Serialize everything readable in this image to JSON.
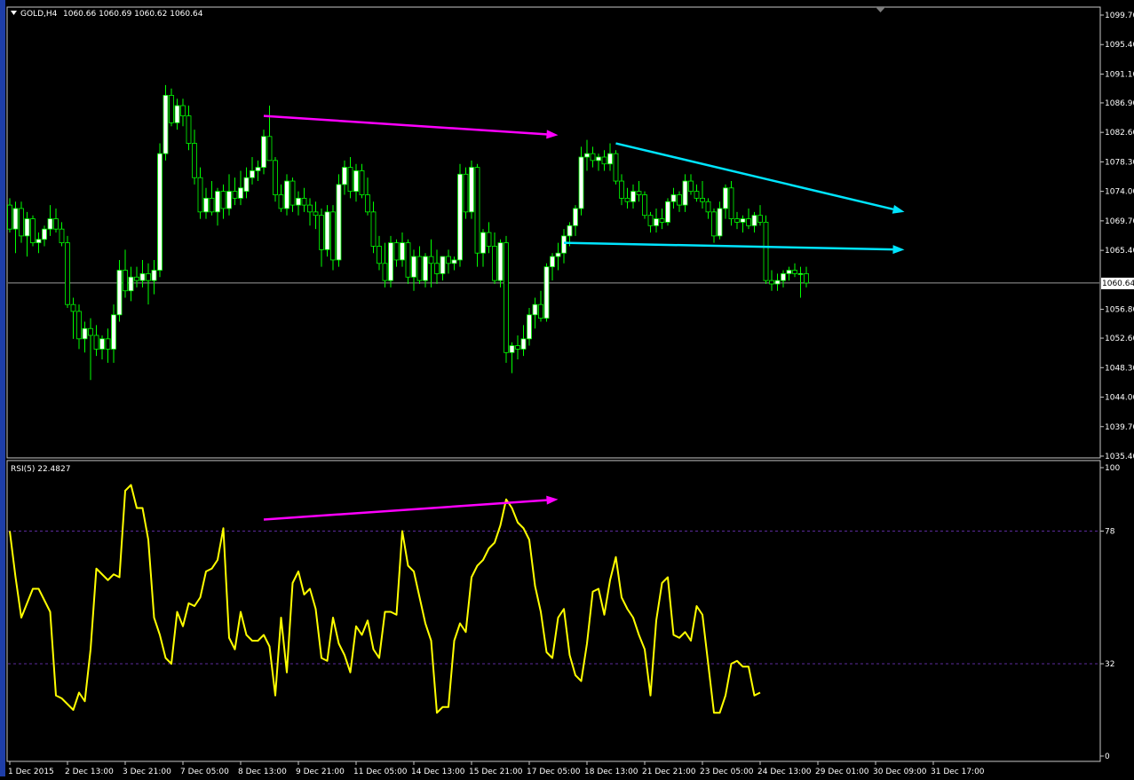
{
  "chart_data": [
    {
      "type": "candlestick",
      "title": "GOLD,H4",
      "ohlc_header": "1060.66 1060.69 1060.62 1060.64",
      "current_price_label": "1060.64",
      "current_price": 1060.64,
      "ylim": [
        1035.4,
        1099.7
      ],
      "y_ticks": [
        "1099.70",
        "1095.40",
        "1091.10",
        "1086.90",
        "1082.60",
        "1078.30",
        "1074.00",
        "1069.70",
        "1065.40",
        "1060.64",
        "1056.80",
        "1052.60",
        "1048.30",
        "1044.00",
        "1039.70",
        "1035.40"
      ],
      "x_ticks": [
        "1 Dec 2015",
        "2 Dec 13:00",
        "3 Dec 21:00",
        "7 Dec 05:00",
        "8 Dec 13:00",
        "9 Dec 21:00",
        "11 Dec 05:00",
        "14 Dec 13:00",
        "15 Dec 21:00",
        "17 Dec 05:00",
        "18 Dec 13:00",
        "21 Dec 21:00",
        "23 Dec 05:00",
        "24 Dec 13:00",
        "29 Dec 01:00",
        "30 Dec 09:00",
        "31 Dec 17:00"
      ],
      "grid": false,
      "candle_colors": {
        "bull_body": "#ffffff",
        "bear_body": "#000000",
        "wick": "#00ff00"
      },
      "candles": [
        [
          1072.0,
          1073.0,
          1068.0,
          1068.5
        ],
        [
          1068.5,
          1072.5,
          1065.0,
          1071.5
        ],
        [
          1071.5,
          1072.5,
          1066.5,
          1067.5
        ],
        [
          1067.5,
          1071.0,
          1064.5,
          1070.0
        ],
        [
          1070.0,
          1070.5,
          1066.0,
          1066.5
        ],
        [
          1066.5,
          1068.0,
          1065.0,
          1067.0
        ],
        [
          1067.0,
          1069.0,
          1066.0,
          1068.5
        ],
        [
          1068.5,
          1072.0,
          1067.5,
          1070.0
        ],
        [
          1070.0,
          1071.5,
          1068.0,
          1068.5
        ],
        [
          1068.5,
          1069.5,
          1066.0,
          1066.5
        ],
        [
          1066.5,
          1067.5,
          1057.0,
          1057.5
        ],
        [
          1057.5,
          1058.5,
          1052.5,
          1056.5
        ],
        [
          1056.5,
          1057.5,
          1051.0,
          1052.5
        ],
        [
          1052.5,
          1055.0,
          1050.5,
          1054.0
        ],
        [
          1054.0,
          1055.5,
          1046.5,
          1053.0
        ],
        [
          1053.0,
          1054.5,
          1050.0,
          1051.0
        ],
        [
          1051.0,
          1053.0,
          1049.5,
          1052.5
        ],
        [
          1052.5,
          1054.0,
          1049.0,
          1051.0
        ],
        [
          1051.0,
          1057.5,
          1049.0,
          1056.0
        ],
        [
          1056.0,
          1064.0,
          1055.0,
          1062.5
        ],
        [
          1062.5,
          1065.5,
          1058.5,
          1059.5
        ],
        [
          1059.5,
          1063.0,
          1058.0,
          1061.5
        ],
        [
          1061.5,
          1063.0,
          1060.0,
          1061.0
        ],
        [
          1061.0,
          1064.0,
          1060.0,
          1062.0
        ],
        [
          1062.0,
          1063.5,
          1057.5,
          1061.0
        ],
        [
          1061.0,
          1064.0,
          1059.0,
          1062.5
        ],
        [
          1062.5,
          1081.0,
          1061.5,
          1079.5
        ],
        [
          1079.5,
          1089.5,
          1078.5,
          1088.0
        ],
        [
          1088.0,
          1089.0,
          1083.5,
          1084.0
        ],
        [
          1084.0,
          1087.5,
          1083.0,
          1086.5
        ],
        [
          1086.5,
          1087.5,
          1083.5,
          1085.0
        ],
        [
          1085.0,
          1086.5,
          1080.0,
          1081.0
        ],
        [
          1081.0,
          1083.0,
          1075.0,
          1076.0
        ],
        [
          1076.0,
          1077.5,
          1070.0,
          1071.0
        ],
        [
          1071.0,
          1074.5,
          1070.0,
          1073.0
        ],
        [
          1073.0,
          1075.5,
          1070.5,
          1071.0
        ],
        [
          1071.0,
          1074.5,
          1069.0,
          1074.0
        ],
        [
          1074.0,
          1075.0,
          1070.0,
          1071.5
        ],
        [
          1071.5,
          1076.5,
          1070.5,
          1074.0
        ],
        [
          1074.0,
          1076.0,
          1072.0,
          1073.0
        ],
        [
          1073.0,
          1077.0,
          1072.0,
          1074.5
        ],
        [
          1074.0,
          1077.5,
          1073.0,
          1076.0
        ],
        [
          1076.0,
          1079.0,
          1075.0,
          1077.0
        ],
        [
          1077.0,
          1078.5,
          1075.5,
          1077.5
        ],
        [
          1077.5,
          1083.0,
          1076.5,
          1082.0
        ],
        [
          1082.0,
          1086.5,
          1080.0,
          1078.5
        ],
        [
          1078.5,
          1079.0,
          1072.5,
          1073.5
        ],
        [
          1073.5,
          1075.0,
          1071.0,
          1071.5
        ],
        [
          1071.5,
          1076.5,
          1070.5,
          1075.5
        ],
        [
          1075.5,
          1076.0,
          1071.0,
          1072.0
        ],
        [
          1072.0,
          1074.0,
          1070.5,
          1073.0
        ],
        [
          1073.0,
          1074.5,
          1071.0,
          1072.0
        ],
        [
          1072.0,
          1073.0,
          1069.0,
          1071.0
        ],
        [
          1071.0,
          1072.5,
          1068.5,
          1070.5
        ],
        [
          1070.5,
          1071.5,
          1063.0,
          1065.5
        ],
        [
          1065.5,
          1072.0,
          1064.5,
          1071.0
        ],
        [
          1071.0,
          1072.0,
          1062.5,
          1064.0
        ],
        [
          1064.0,
          1076.5,
          1063.0,
          1075.0
        ],
        [
          1075.0,
          1078.5,
          1073.5,
          1077.5
        ],
        [
          1077.5,
          1079.0,
          1073.0,
          1074.0
        ],
        [
          1074.0,
          1078.0,
          1072.5,
          1077.0
        ],
        [
          1077.0,
          1078.0,
          1073.0,
          1073.5
        ],
        [
          1073.5,
          1076.0,
          1070.5,
          1071.0
        ],
        [
          1071.0,
          1072.5,
          1065.0,
          1066.0
        ],
        [
          1066.0,
          1067.5,
          1062.5,
          1063.5
        ],
        [
          1063.5,
          1066.5,
          1060.0,
          1061.0
        ],
        [
          1061.0,
          1067.5,
          1060.0,
          1066.5
        ],
        [
          1066.5,
          1067.0,
          1063.0,
          1064.0
        ],
        [
          1064.0,
          1068.0,
          1063.0,
          1066.5
        ],
        [
          1066.5,
          1067.0,
          1060.5,
          1061.5
        ],
        [
          1061.5,
          1065.5,
          1059.5,
          1064.5
        ],
        [
          1064.5,
          1066.0,
          1060.5,
          1061.0
        ],
        [
          1061.0,
          1065.0,
          1060.0,
          1064.5
        ],
        [
          1064.5,
          1067.0,
          1060.0,
          1063.5
        ],
        [
          1063.5,
          1065.5,
          1060.5,
          1062.0
        ],
        [
          1062.0,
          1064.5,
          1061.0,
          1064.5
        ],
        [
          1064.5,
          1065.5,
          1062.0,
          1063.5
        ],
        [
          1063.5,
          1064.5,
          1062.5,
          1064.0
        ],
        [
          1064.0,
          1078.0,
          1063.0,
          1076.5
        ],
        [
          1076.5,
          1077.5,
          1070.0,
          1071.0
        ],
        [
          1071.0,
          1078.5,
          1070.0,
          1077.5
        ],
        [
          1077.5,
          1078.0,
          1063.0,
          1065.0
        ],
        [
          1065.0,
          1068.5,
          1063.0,
          1068.0
        ],
        [
          1068.0,
          1069.5,
          1065.0,
          1066.0
        ],
        [
          1066.0,
          1068.0,
          1060.5,
          1061.0
        ],
        [
          1061.0,
          1067.0,
          1060.0,
          1066.5
        ],
        [
          1066.5,
          1067.5,
          1049.0,
          1050.5
        ],
        [
          1050.5,
          1052.0,
          1047.5,
          1051.5
        ],
        [
          1051.5,
          1053.0,
          1049.5,
          1051.0
        ],
        [
          1051.0,
          1054.5,
          1050.0,
          1052.5
        ],
        [
          1052.5,
          1057.0,
          1051.5,
          1056.0
        ],
        [
          1056.0,
          1058.5,
          1054.0,
          1057.5
        ],
        [
          1057.5,
          1059.5,
          1055.0,
          1055.5
        ],
        [
          1055.5,
          1063.5,
          1055.0,
          1063.0
        ],
        [
          1063.0,
          1065.0,
          1061.0,
          1064.5
        ],
        [
          1064.5,
          1066.5,
          1062.5,
          1065.0
        ],
        [
          1065.0,
          1068.5,
          1063.5,
          1067.5
        ],
        [
          1067.5,
          1069.5,
          1066.0,
          1069.0
        ],
        [
          1069.0,
          1072.0,
          1067.5,
          1071.5
        ],
        [
          1071.5,
          1080.5,
          1070.5,
          1079.0
        ],
        [
          1079.0,
          1081.5,
          1077.0,
          1079.5
        ],
        [
          1079.5,
          1080.5,
          1077.5,
          1078.5
        ],
        [
          1078.5,
          1079.5,
          1077.0,
          1079.0
        ],
        [
          1079.0,
          1080.0,
          1077.0,
          1078.0
        ],
        [
          1078.0,
          1081.0,
          1077.0,
          1079.5
        ],
        [
          1079.5,
          1080.0,
          1075.0,
          1075.5
        ],
        [
          1075.5,
          1076.5,
          1072.0,
          1073.0
        ],
        [
          1073.0,
          1074.5,
          1071.5,
          1072.5
        ],
        [
          1072.5,
          1075.0,
          1071.5,
          1074.0
        ],
        [
          1074.0,
          1075.5,
          1072.5,
          1073.5
        ],
        [
          1073.5,
          1074.0,
          1070.0,
          1070.5
        ],
        [
          1070.5,
          1071.0,
          1068.0,
          1069.0
        ],
        [
          1069.0,
          1071.5,
          1068.0,
          1070.0
        ],
        [
          1070.0,
          1071.5,
          1068.5,
          1069.5
        ],
        [
          1069.5,
          1073.0,
          1069.0,
          1072.5
        ],
        [
          1072.5,
          1074.5,
          1071.5,
          1073.5
        ],
        [
          1073.5,
          1074.0,
          1071.0,
          1072.0
        ],
        [
          1072.0,
          1076.5,
          1071.0,
          1075.5
        ],
        [
          1075.5,
          1076.5,
          1073.5,
          1074.0
        ],
        [
          1074.0,
          1075.0,
          1072.5,
          1073.0
        ],
        [
          1073.0,
          1075.5,
          1071.5,
          1072.5
        ],
        [
          1072.5,
          1073.0,
          1070.0,
          1071.0
        ],
        [
          1071.0,
          1071.5,
          1066.5,
          1067.5
        ],
        [
          1067.5,
          1072.5,
          1067.0,
          1071.5
        ],
        [
          1071.5,
          1075.0,
          1070.0,
          1074.5
        ],
        [
          1074.5,
          1075.5,
          1069.0,
          1070.0
        ],
        [
          1070.0,
          1071.0,
          1068.5,
          1069.5
        ],
        [
          1069.5,
          1070.5,
          1068.0,
          1070.0
        ],
        [
          1070.0,
          1071.5,
          1068.5,
          1069.0
        ],
        [
          1069.0,
          1071.0,
          1068.0,
          1070.5
        ],
        [
          1070.5,
          1072.0,
          1069.0,
          1069.5
        ],
        [
          1069.5,
          1070.5,
          1060.5,
          1061.0
        ],
        [
          1061.0,
          1062.5,
          1059.5,
          1060.5
        ],
        [
          1060.5,
          1062.0,
          1059.5,
          1061.0
        ],
        [
          1061.0,
          1062.5,
          1060.0,
          1062.0
        ],
        [
          1062.0,
          1063.0,
          1061.0,
          1062.5
        ],
        [
          1062.5,
          1063.5,
          1061.5,
          1062.0
        ],
        [
          1062.0,
          1063.0,
          1058.5,
          1062.0
        ],
        [
          1062.0,
          1063.0,
          1060.0,
          1060.64
        ]
      ],
      "annotations": [
        {
          "kind": "arrow",
          "color": "#ff00ff",
          "from": {
            "bar": 44,
            "price": 1085.0
          },
          "to": {
            "bar": 95,
            "price": 1082.2
          }
        },
        {
          "kind": "arrow",
          "color": "#00e5ff",
          "from": {
            "bar": 105,
            "price": 1081.0
          },
          "to": {
            "bar": 155,
            "price": 1071.0
          }
        },
        {
          "kind": "arrow",
          "color": "#00e5ff",
          "from": {
            "bar": 96,
            "price": 1066.5
          },
          "to": {
            "bar": 155,
            "price": 1065.5
          }
        }
      ]
    },
    {
      "type": "line",
      "title": "RSI(5) 22.4827",
      "ylim": [
        0,
        100
      ],
      "y_ticks": [
        "100",
        "78",
        "32",
        "0"
      ],
      "levels": [
        78,
        32
      ],
      "level_color": "#5b2a9b",
      "series": [
        {
          "name": "RSI(5)",
          "color": "#ffff00",
          "values": [
            78,
            62,
            48,
            53,
            58,
            58,
            54,
            50,
            21,
            20,
            18,
            16,
            22,
            19,
            37,
            65,
            63,
            61,
            63,
            62,
            92,
            94,
            86,
            86,
            75,
            48,
            42,
            34,
            32,
            50,
            45,
            53,
            52,
            55,
            64,
            65,
            68,
            79,
            41,
            37,
            50,
            42,
            40,
            40,
            42,
            38,
            21,
            48,
            29,
            60,
            64,
            56,
            58,
            51,
            34,
            33,
            48,
            39,
            35,
            29,
            45,
            42,
            47,
            37,
            34,
            50,
            50,
            49,
            78,
            66,
            64,
            55,
            46,
            40,
            15,
            17,
            17,
            40,
            46,
            43,
            62,
            66,
            68,
            72,
            74,
            80,
            89,
            86,
            81,
            79,
            75,
            59,
            50,
            36,
            34,
            48,
            51,
            35,
            28,
            26,
            39,
            57,
            58,
            49,
            61,
            69,
            55,
            51,
            48,
            42,
            37,
            21,
            47,
            60,
            62,
            42,
            41,
            43,
            40,
            52,
            49,
            32,
            15,
            15,
            21,
            32,
            33,
            31,
            31,
            21,
            22
          ]
        }
      ],
      "annotations": [
        {
          "kind": "arrow",
          "color": "#ff00ff",
          "from": {
            "bar": 44,
            "value": 82
          },
          "to": {
            "bar": 95,
            "value": 89
          }
        }
      ]
    }
  ]
}
